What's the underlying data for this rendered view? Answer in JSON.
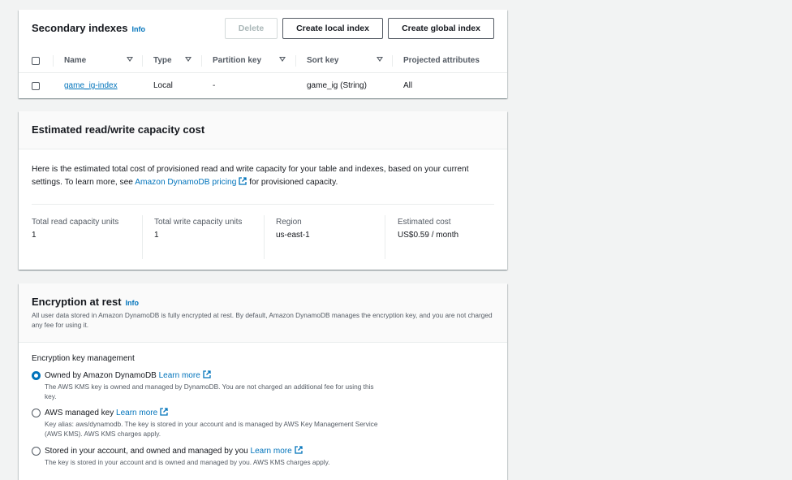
{
  "secondary_indexes": {
    "title": "Secondary indexes",
    "info": "Info",
    "buttons": {
      "delete": "Delete",
      "create_local": "Create local index",
      "create_global": "Create global index"
    },
    "columns": [
      "Name",
      "Type",
      "Partition key",
      "Sort key",
      "Projected attributes"
    ],
    "rows": [
      {
        "name": "game_ig-index",
        "type": "Local",
        "partition_key": "-",
        "sort_key": "game_ig (String)",
        "projected": "All"
      }
    ]
  },
  "capacity_cost": {
    "title": "Estimated read/write capacity cost",
    "desc_line1": "Here is the estimated total cost of provisioned read and write capacity for your table and indexes, based on your current",
    "desc_pre": "settings. To learn more, see ",
    "desc_link": "Amazon DynamoDB pricing",
    "desc_post": " for provisioned capacity.",
    "stats": [
      {
        "label": "Total read capacity units",
        "value": "1"
      },
      {
        "label": "Total write capacity units",
        "value": "1"
      },
      {
        "label": "Region",
        "value": "us-east-1"
      },
      {
        "label": "Estimated cost",
        "value": "US$0.59 / month"
      }
    ]
  },
  "encryption": {
    "title": "Encryption at rest",
    "info": "Info",
    "desc": "All user data stored in Amazon DynamoDB is fully encrypted at rest. By default, Amazon DynamoDB manages the encryption key, and you are not charged any fee for using it.",
    "key_management_label": "Encryption key management",
    "options": [
      {
        "title": "Owned by Amazon DynamoDB",
        "link": "Learn more",
        "desc": "The AWS KMS key is owned and managed by DynamoDB. You are not charged an additional fee for using this key.",
        "selected": true
      },
      {
        "title": "AWS managed key",
        "link": "Learn more",
        "desc": "Key alias: aws/dynamodb. The key is stored in your account and is managed by AWS Key Management Service (AWS KMS). AWS KMS charges apply.",
        "selected": false
      },
      {
        "title": "Stored in your account, and owned and managed by you",
        "link": "Learn more",
        "desc": "The key is stored in your account and is owned and managed by you. AWS KMS charges apply.",
        "selected": false
      }
    ]
  },
  "colors": {
    "link": "#0073bb",
    "text": "#16191f",
    "muted": "#545b64",
    "background": "#f2f3f3"
  }
}
